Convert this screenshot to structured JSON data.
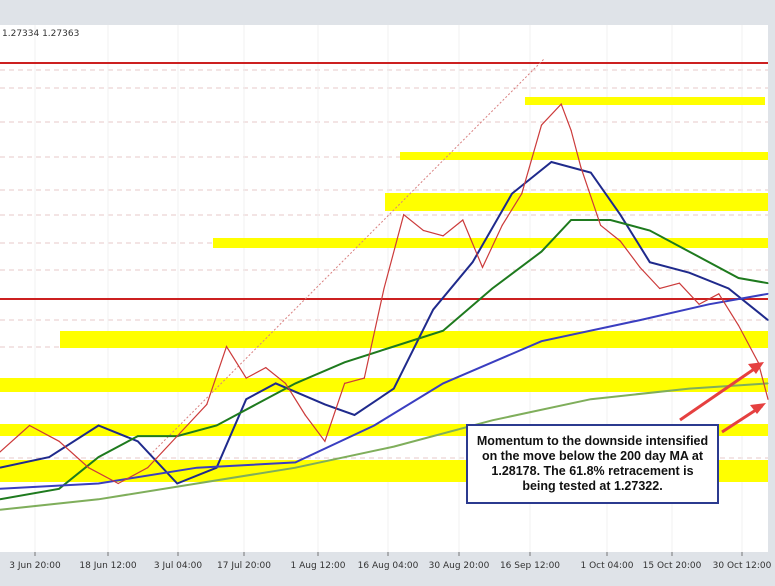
{
  "header": {
    "price_text": "1.27334 1.27363"
  },
  "chart_data": {
    "type": "line",
    "title": "",
    "xlabel": "",
    "ylabel": "",
    "x_tick_labels": [
      "3 Jun 20:00",
      "18 Jun 12:00",
      "3 Jul 04:00",
      "17 Jul 20:00",
      "1 Aug 12:00",
      "16 Aug 04:00",
      "30 Aug 20:00",
      "16 Sep 12:00",
      "1 Oct 04:00",
      "15 Oct 20:00",
      "30 Oct 12:00"
    ],
    "ylim": [
      1.25,
      1.35
    ],
    "series": [
      {
        "color": "#1f2a8c",
        "points": [
          [
            0,
            1.266
          ],
          [
            5,
            1.268
          ],
          [
            10,
            1.274
          ],
          [
            14,
            1.271
          ],
          [
            18,
            1.263
          ],
          [
            22,
            1.266
          ],
          [
            25,
            1.279
          ],
          [
            28,
            1.282
          ],
          [
            33,
            1.278
          ],
          [
            36,
            1.276
          ],
          [
            40,
            1.281
          ],
          [
            44,
            1.296
          ],
          [
            48,
            1.305
          ],
          [
            52,
            1.318
          ],
          [
            56,
            1.324
          ],
          [
            60,
            1.322
          ],
          [
            63,
            1.314
          ],
          [
            66,
            1.305
          ],
          [
            70,
            1.303
          ],
          [
            74,
            1.3
          ],
          [
            78,
            1.294
          ]
        ]
      },
      {
        "color": "#1e7a1e",
        "points": [
          [
            0,
            1.26
          ],
          [
            6,
            1.262
          ],
          [
            10,
            1.268
          ],
          [
            14,
            1.272
          ],
          [
            18,
            1.272
          ],
          [
            22,
            1.274
          ],
          [
            26,
            1.278
          ],
          [
            30,
            1.282
          ],
          [
            35,
            1.286
          ],
          [
            40,
            1.289
          ],
          [
            45,
            1.292
          ],
          [
            50,
            1.3
          ],
          [
            55,
            1.307
          ],
          [
            58,
            1.313
          ],
          [
            62,
            1.313
          ],
          [
            66,
            1.311
          ],
          [
            70,
            1.307
          ],
          [
            75,
            1.302
          ],
          [
            78,
            1.301
          ]
        ]
      },
      {
        "color": "#7fae5b",
        "points": [
          [
            0,
            1.258
          ],
          [
            10,
            1.26
          ],
          [
            20,
            1.263
          ],
          [
            30,
            1.266
          ],
          [
            40,
            1.27
          ],
          [
            50,
            1.275
          ],
          [
            60,
            1.279
          ],
          [
            70,
            1.281
          ],
          [
            78,
            1.282
          ]
        ]
      },
      {
        "color": "#3a3ec0",
        "points": [
          [
            0,
            1.262
          ],
          [
            10,
            1.263
          ],
          [
            20,
            1.266
          ],
          [
            30,
            1.267
          ],
          [
            38,
            1.274
          ],
          [
            45,
            1.282
          ],
          [
            55,
            1.29
          ],
          [
            65,
            1.294
          ],
          [
            72,
            1.297
          ],
          [
            78,
            1.299
          ]
        ]
      },
      {
        "color": "#cc3b3b",
        "points": [
          [
            0,
            1.269
          ],
          [
            3,
            1.274
          ],
          [
            6,
            1.271
          ],
          [
            9,
            1.266
          ],
          [
            12,
            1.263
          ],
          [
            15,
            1.266
          ],
          [
            18,
            1.272
          ],
          [
            21,
            1.278
          ],
          [
            23,
            1.289
          ],
          [
            25,
            1.283
          ],
          [
            27,
            1.285
          ],
          [
            29,
            1.282
          ],
          [
            31,
            1.276
          ],
          [
            33,
            1.271
          ],
          [
            35,
            1.282
          ],
          [
            37,
            1.283
          ],
          [
            39,
            1.3
          ],
          [
            41,
            1.314
          ],
          [
            43,
            1.311
          ],
          [
            45,
            1.31
          ],
          [
            47,
            1.313
          ],
          [
            49,
            1.304
          ],
          [
            51,
            1.312
          ],
          [
            53,
            1.318
          ],
          [
            55,
            1.331
          ],
          [
            57,
            1.335
          ],
          [
            58,
            1.33
          ],
          [
            59,
            1.323
          ],
          [
            61,
            1.312
          ],
          [
            63,
            1.309
          ],
          [
            65,
            1.304
          ],
          [
            67,
            1.3
          ],
          [
            69,
            1.301
          ],
          [
            71,
            1.297
          ],
          [
            73,
            1.299
          ],
          [
            75,
            1.293
          ],
          [
            77,
            1.286
          ],
          [
            78,
            1.279
          ]
        ]
      }
    ],
    "horizontal_zones": [
      "yellow-band",
      "yellow-band",
      "yellow-band",
      "yellow-band",
      "yellow-band",
      "yellow-band",
      "yellow-band",
      "yellow-band",
      "yellow-band"
    ],
    "annotation": "Momentum to the downside intensified on the move below the 200 day MA at 1.28178. The 61.8% retracement is being tested at 1.27322.",
    "grid": true
  },
  "colors": {
    "background": "#ffffff",
    "frame": "#dfe3e8",
    "zone": "#ffff00",
    "arrow": "#e54040",
    "hline": "#cc2020"
  }
}
